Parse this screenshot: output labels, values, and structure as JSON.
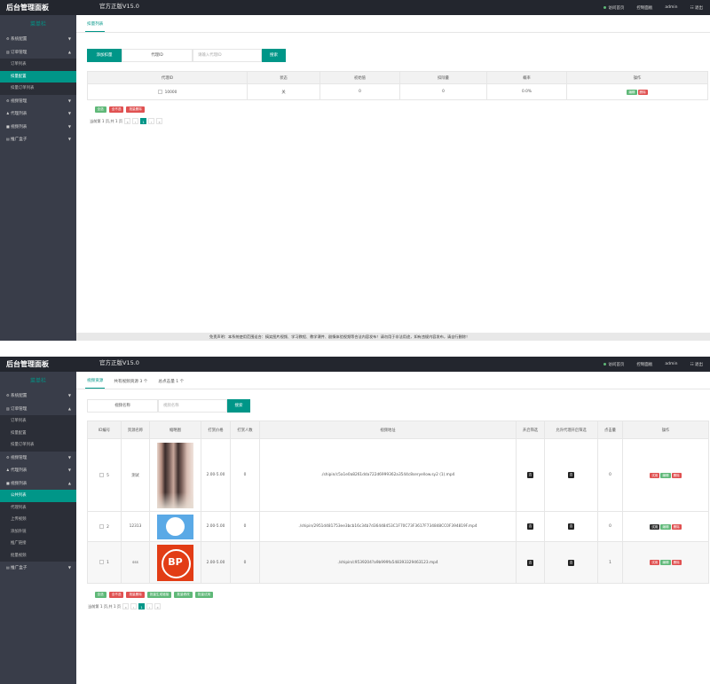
{
  "app": {
    "title": "后台管理面板",
    "version": "官方正版V15.0",
    "visit_site": "访问首页",
    "control_panel": "控制面板",
    "user": "admin",
    "logout": "退出",
    "sidebar_header": "菜单栏"
  },
  "panel1": {
    "nav": [
      {
        "label": "系统配置",
        "arrow": "▼"
      },
      {
        "label": "订单管理",
        "arrow": "▲"
      }
    ],
    "sub": [
      "订单列表",
      "扣量配置",
      "扣量订单列表"
    ],
    "nav_after": [
      {
        "label": "视频管理",
        "arrow": "▼"
      },
      {
        "label": "代理列表",
        "arrow": "▼"
      },
      {
        "label": "视频列表",
        "arrow": "▼"
      },
      {
        "label": "推广盒子",
        "arrow": "▼"
      }
    ],
    "tab": "扣量列表",
    "add_button": "添加扣量",
    "agent_label": "代理ID",
    "agent_placeholder": "请输入代理ID",
    "search_button": "搜索",
    "table": {
      "headers": [
        "代理ID",
        "状态",
        "初始值",
        "扣除量",
        "概率",
        "操作"
      ],
      "rows": [
        {
          "id": "10000",
          "status": "关",
          "initial": "0",
          "deduct": "0",
          "prob": "0.0%",
          "edit": "编辑",
          "del": "删除"
        }
      ]
    },
    "batch": [
      "全选",
      "全不选",
      "批量删除"
    ],
    "pager": {
      "info": "当前第 1 页,共 1 页",
      "first": "«",
      "prev": "‹",
      "current": "1",
      "next": "›",
      "last": "»"
    },
    "footer": "免责声明：本系统使用范围适合：搞笑图片视频、学习教程、教学课件、剧情体验视频等合法内容发布！请勿用于非法用途，如有违规内容发布，请自行删除！"
  },
  "panel2": {
    "nav": [
      {
        "label": "系统配置",
        "arrow": "▼"
      },
      {
        "label": "订单管理",
        "arrow": "▲"
      }
    ],
    "sub_orders": [
      "订单列表",
      "扣量配置",
      "扣量订单列表"
    ],
    "nav_mid": [
      {
        "label": "视频管理",
        "arrow": "▼"
      },
      {
        "label": "代理列表",
        "arrow": "▼"
      },
      {
        "label": "视频列表",
        "arrow": "▲"
      }
    ],
    "sub_videos": [
      "公共列表",
      "代理列表",
      "上传视频",
      "添加外链",
      "推广链接",
      "批量视频"
    ],
    "nav_last": {
      "label": "推广盒子",
      "arrow": "▼"
    },
    "tabs": [
      "视频资源",
      "共有视频资源 3 个",
      "总点击量 1 个"
    ],
    "name_label": "视频名称",
    "name_placeholder": "视频名称",
    "search_button": "搜索",
    "table": {
      "headers": [
        "ID编号",
        "资源名称",
        "缩略图",
        "打赏价格",
        "打赏人数",
        "视频地址",
        "开启筛选",
        "允许代理开启筛选",
        "点击量",
        "操作"
      ],
      "rows": [
        {
          "id": "5",
          "name": "测试",
          "thumb": "photo-thumbnail",
          "price": "2.00-5.00",
          "payers": "0",
          "url": "./shipin/c5a1e0a8261dda722d6999362a3544c8seryellow.sy2 (1).mp4",
          "filter": "否",
          "agent_filter": "否",
          "clicks": "0",
          "try": "试用",
          "edit": "编辑",
          "del": "删除"
        },
        {
          "id": "2",
          "name": "12313",
          "thumb": "blue-circle-thumbnail",
          "price": "2.00-5.00",
          "payers": "0",
          "url": "./shipin/2951d481753ee3bcb16c34b7d36448453C1F70C73F3617F734848CC0F394819F.mp4",
          "filter": "否",
          "agent_filter": "否",
          "clicks": "0",
          "try": "试用",
          "edit": "编辑",
          "del": "删除"
        },
        {
          "id": "1",
          "name": "sss",
          "thumb": "bp-logo-thumbnail",
          "bp": "BP",
          "price": "2.00-5.00",
          "payers": "0",
          "url": "./shipin/c9539204?a9b999fa548393329463123.mp4",
          "filter": "否",
          "agent_filter": "否",
          "clicks": "1",
          "try": "试用",
          "edit": "编辑",
          "del": "删除"
        }
      ]
    },
    "batch": [
      "全选",
      "全不选",
      "批量删除",
      "批量生成链接",
      "批量修改",
      "批量试用"
    ],
    "pager": {
      "info": "当前第 1 页,共 1 页",
      "first": "«",
      "prev": "‹",
      "current": "1",
      "next": "›",
      "last": "»"
    }
  },
  "colors": {
    "accent": "#009688",
    "sidebar": "#393d49",
    "topbar": "#23262e",
    "green": "#5fb878",
    "red": "#e05151"
  }
}
